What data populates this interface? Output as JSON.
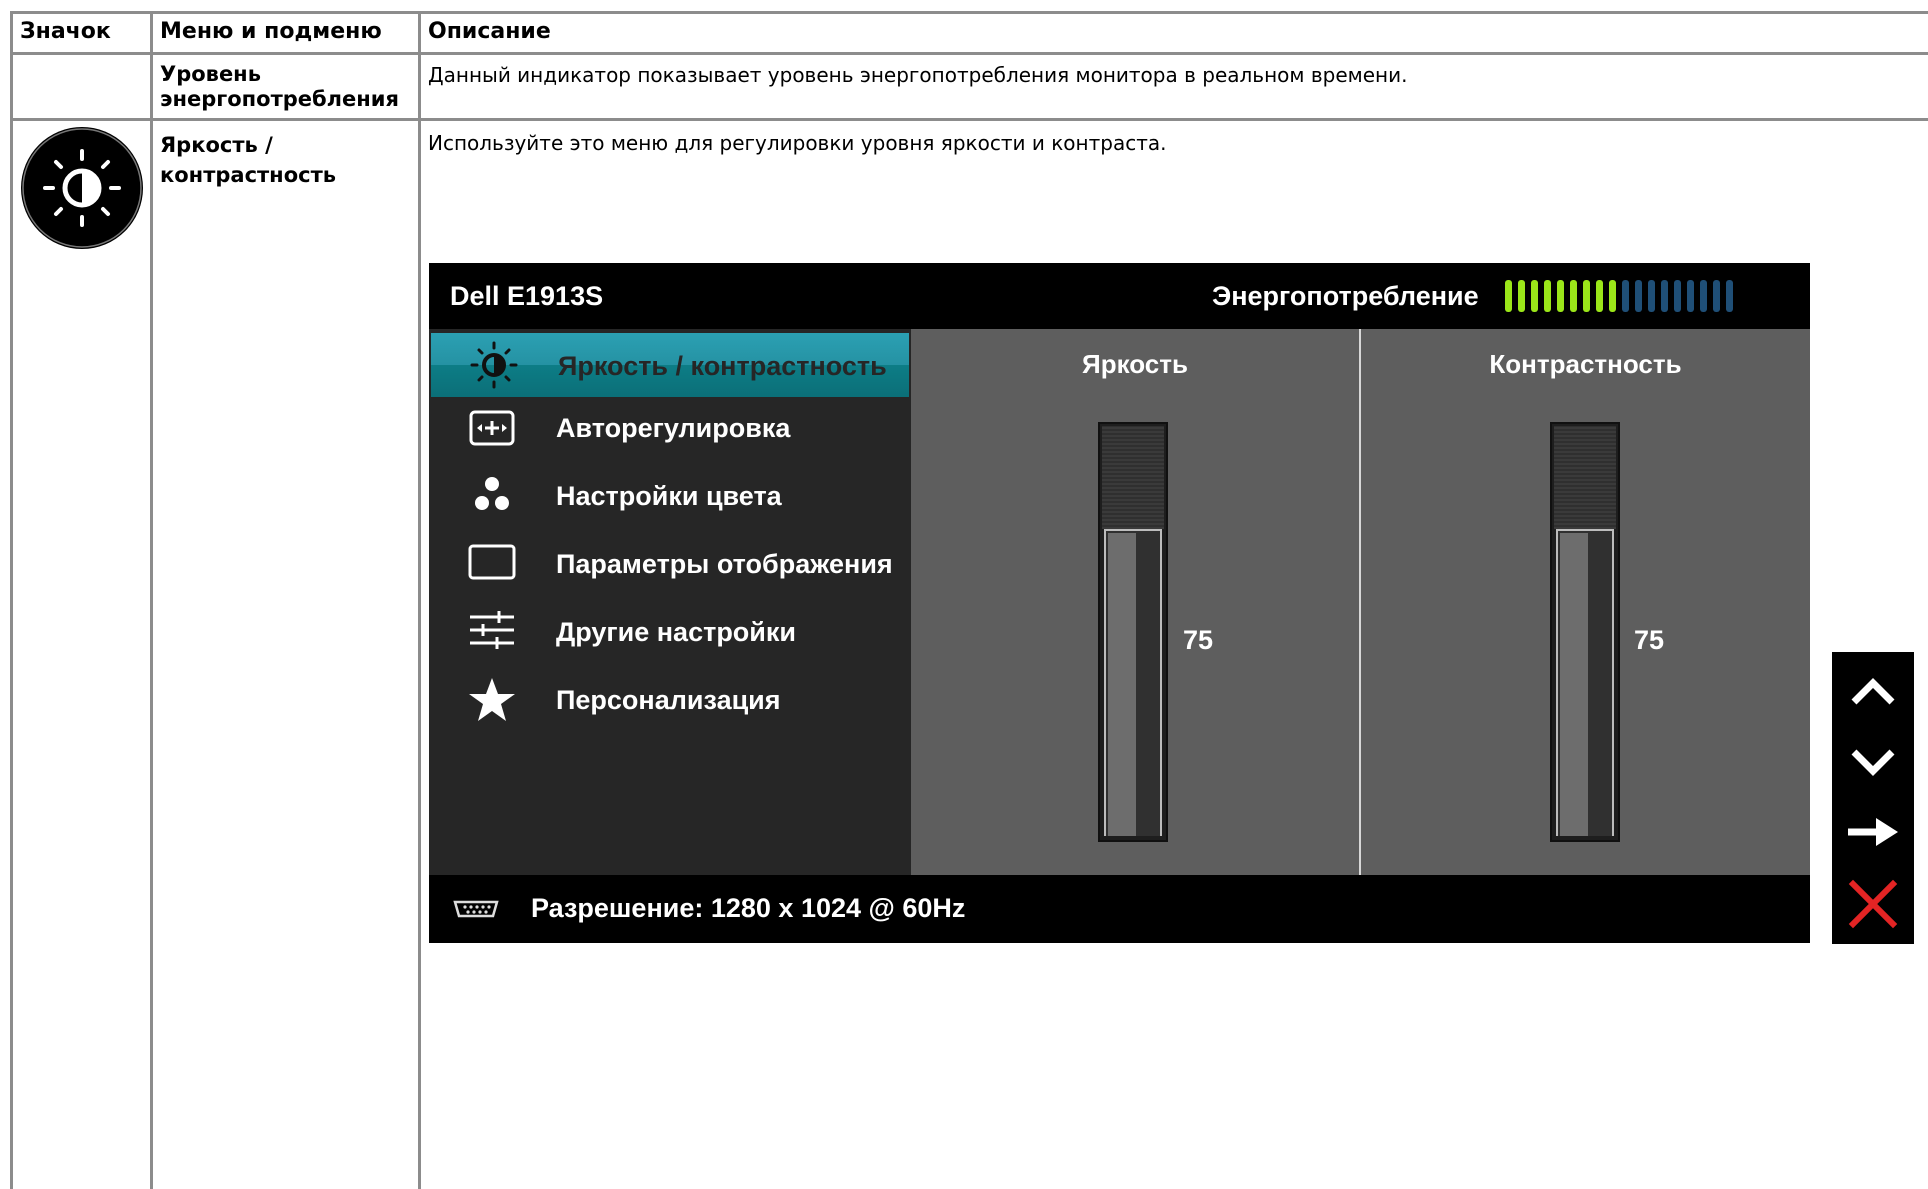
{
  "table": {
    "headers": {
      "icon": "Значок",
      "menu": "Меню и подменю",
      "description": "Описание"
    },
    "rows": [
      {
        "menu_line1": "Уровень",
        "menu_line2": "энергопотребления",
        "description": "Данный индикатор показывает уровень энергопотребления монитора в реальном времени."
      },
      {
        "icon_name": "brightness-contrast-icon",
        "menu_line1": "Яркость /",
        "menu_line2": "контрастность",
        "description": "Используйте это меню для регулировки уровня яркости и контраста."
      }
    ]
  },
  "osd": {
    "model": "Dell E1913S",
    "energy_label": "Энергопотребление",
    "energy_level": {
      "active": 9,
      "total": 18
    },
    "colors": {
      "energy_active": "#9be619",
      "energy_inactive": "#1f4f77",
      "menu_highlight": "#2597a8",
      "close": "#e32424"
    },
    "menu": [
      {
        "icon": "brightness-contrast-icon",
        "label": "Яркость / контрастность",
        "active": true
      },
      {
        "icon": "auto-adjust-icon",
        "label": "Авторегулировка"
      },
      {
        "icon": "color-settings-icon",
        "label": "Настройки цвета"
      },
      {
        "icon": "display-settings-icon",
        "label": "Параметры отображения"
      },
      {
        "icon": "other-settings-icon",
        "label": "Другие настройки"
      },
      {
        "icon": "personalize-star-icon",
        "label": "Персонализация"
      }
    ],
    "brightness": {
      "label": "Яркость",
      "value": "75",
      "level": 0.75
    },
    "contrast": {
      "label": "Контрастность",
      "value": "75",
      "level": 0.75
    },
    "resolution": "Разрешение: 1280 x 1024 @ 60Hz",
    "buttons": [
      "up-arrow-icon",
      "down-arrow-icon",
      "right-arrow-icon",
      "close-icon"
    ]
  }
}
